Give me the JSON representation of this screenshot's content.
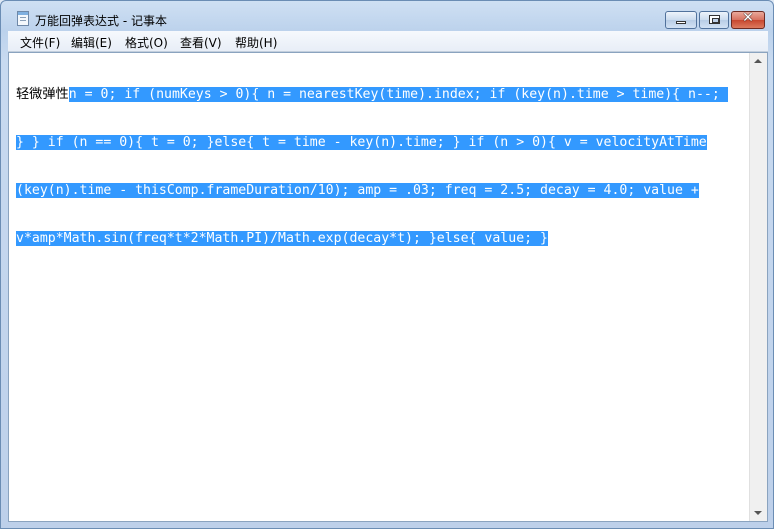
{
  "window": {
    "title": "万能回弹表达式 - 记事本"
  },
  "menu": [
    {
      "label": "文件(F)"
    },
    {
      "label": "编辑(E)"
    },
    {
      "label": "格式(O)"
    },
    {
      "label": "查看(V)"
    },
    {
      "label": "帮助(H)"
    }
  ],
  "caption": {
    "close_glyph": "✕"
  },
  "editor": {
    "lines": [
      {
        "plain": "轻微弹性",
        "selected": "n = 0; if (numKeys > 0){ n = nearestKey(time).index; if (key(n).time > time){ n--; "
      },
      {
        "plain": "",
        "selected": "} } if (n == 0){ t = 0; }else{ t = time - key(n).time; } if (n > 0){ v = velocityAtTime"
      },
      {
        "plain": "",
        "selected": "(key(n).time - thisComp.frameDuration/10); amp = .03; freq = 2.5; decay = 4.0; value +"
      },
      {
        "plain": "",
        "selected": "v*amp*Math.sin(freq*t*2*Math.PI)/Math.exp(decay*t); }else{ value; }"
      }
    ]
  },
  "colors": {
    "selection": "#3399ff",
    "selection_text": "#ffffff"
  }
}
